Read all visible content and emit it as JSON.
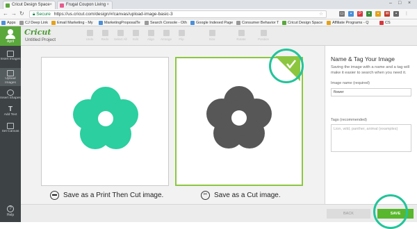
{
  "browser": {
    "tabs": [
      {
        "label": "Cricut Design Space",
        "active": true
      },
      {
        "label": "Frugal Coupon Living",
        "active": false
      }
    ],
    "secure_label": "Secure",
    "url": "https://us.cricut.com/design/#/canvas/upload-image-basic-3",
    "bookmarks": [
      "Apps",
      "CJ Deep Link",
      "Email Marketing - My",
      "MarketingProposalTe",
      "Search Console - Oth",
      "Google Indexed Page",
      "Consumer Behavior T",
      "Cricut Design Space",
      "Affiliate Programs - Q",
      "CS"
    ]
  },
  "app": {
    "logo": "Cricut",
    "project_name": "Untitled Project",
    "user_name": "April",
    "toolbar": [
      "Undo",
      "Redo",
      "Select All",
      "Edit",
      "Align",
      "Arrange",
      "Flip",
      "Size",
      "Rotate",
      "Position"
    ],
    "sidebar": [
      {
        "label": "Insert Images"
      },
      {
        "label": "Upload Images"
      },
      {
        "label": "Insert Shapes"
      },
      {
        "label": "Add Text"
      },
      {
        "label": "Set Canvas"
      }
    ],
    "help_label": "Help"
  },
  "options": {
    "print_cut_label": "Save as a Print Then Cut image.",
    "cut_label": "Save as a Cut image.",
    "selected": "cut",
    "print_flower_color": "#2ccf9f",
    "cut_flower_color": "#575757",
    "accent_color": "#8cc63f"
  },
  "panel": {
    "title": "Name & Tag Your Image",
    "description": "Saving the image with a name and a tag will make it easier to search when you need it.",
    "name_label": "Image name (required)",
    "name_value": "flower",
    "tags_label": "Tags (recommended)",
    "tags_placeholder": "Lion, wild, panther, animal (examples)"
  },
  "actions": {
    "back_label": "BACK",
    "save_label": "SAVE"
  }
}
